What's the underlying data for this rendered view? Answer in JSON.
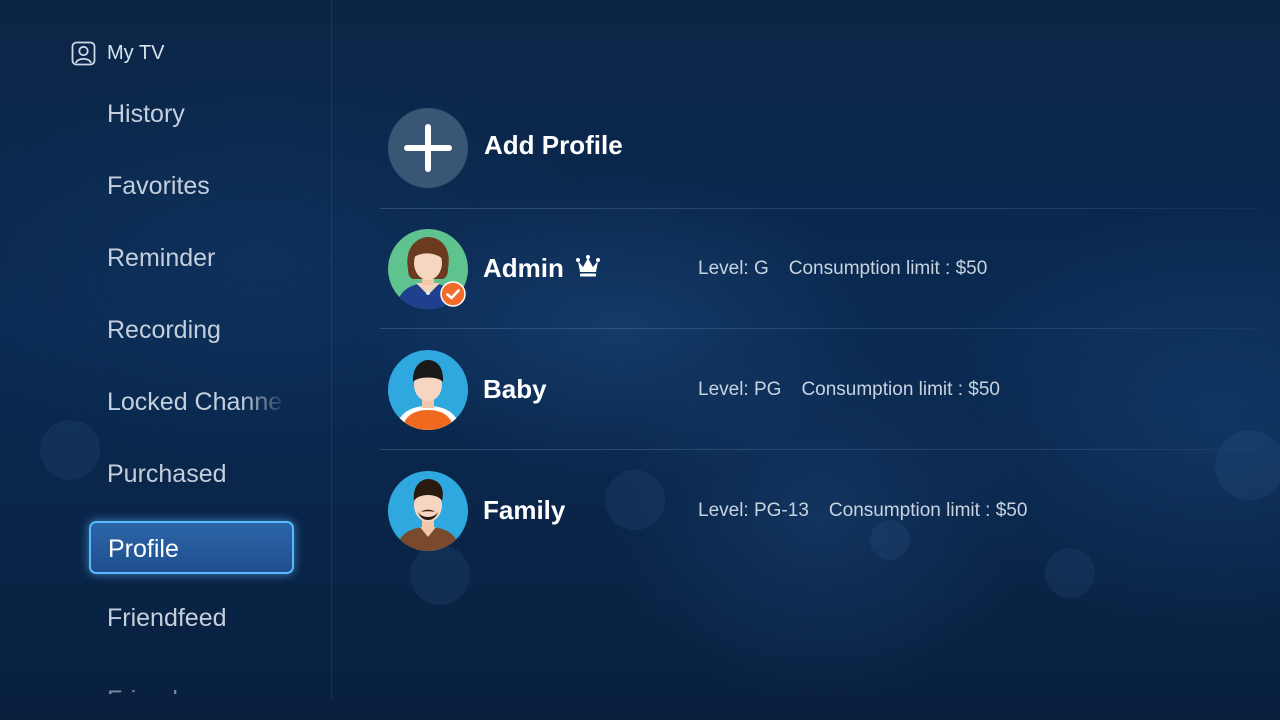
{
  "sidebar": {
    "title": "My TV",
    "title_icon": "user-icon",
    "items": [
      {
        "label": "History"
      },
      {
        "label": "Favorites"
      },
      {
        "label": "Reminder"
      },
      {
        "label": "Recording"
      },
      {
        "label": "Locked Channe"
      },
      {
        "label": "Purchased"
      },
      {
        "label": "Profile",
        "selected": true
      },
      {
        "label": "Friendfeed"
      },
      {
        "label": "Friends"
      }
    ]
  },
  "main": {
    "add_profile": {
      "label": "Add Profile",
      "icon": "plus-icon"
    },
    "profiles": [
      {
        "name": "Admin",
        "badge_icon": "crown-icon",
        "active_icon": "checkmark-icon",
        "level": "Level: G",
        "consumption": "Consumption limit : $50",
        "avatar_icon": "woman-avatar-icon"
      },
      {
        "name": "Baby",
        "level": "Level: PG",
        "consumption": "Consumption limit : $50",
        "avatar_icon": "child-avatar-icon"
      },
      {
        "name": "Family",
        "level": "Level: PG-13",
        "consumption": "Consumption limit : $50",
        "avatar_icon": "man-avatar-icon"
      }
    ]
  },
  "colors": {
    "background": "#0a2a52",
    "selection_border": "#58b7ff",
    "selection_fill": "#2c66a8",
    "check_badge": "#f26b2a",
    "avatar_green": "#5ec38f",
    "avatar_blue": "#2fa8e0"
  }
}
